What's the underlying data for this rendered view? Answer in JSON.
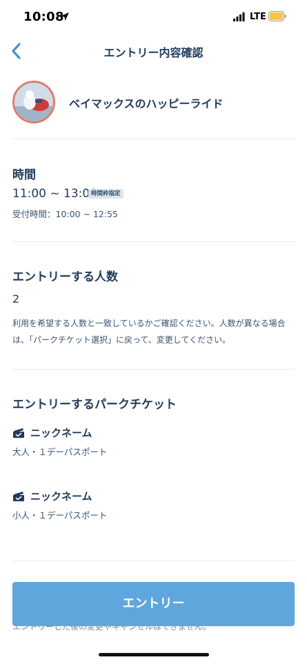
{
  "status_bar": {
    "time": "10:08",
    "network": "LTE"
  },
  "header": {
    "title": "エントリー内容確認",
    "back_icon": "chevron-left-icon"
  },
  "attraction": {
    "name": "ベイマックスのハッピーライド"
  },
  "time_section": {
    "title": "時間",
    "value": "11:00 ~ 13:00",
    "badge": "時間枠指定",
    "reception": "受付時間：10:00 ~ 12:55"
  },
  "people_section": {
    "title": "エントリーする人数",
    "count": "2",
    "note": "利用を希望する人数と一致しているかご確認ください。人数が異なる場合は、「パークチケット選択」に戻って、変更してください。"
  },
  "tickets_section": {
    "title": "エントリーするパークチケット",
    "tickets": [
      {
        "name": "ニックネーム",
        "type": "大人・１デーパスポート"
      },
      {
        "name": "ニックネーム",
        "type": "小人・１デーパスポート"
      }
    ]
  },
  "footer": {
    "button_label": "エントリー",
    "note": "エントリーした後の変更やキャンセルはできません。"
  },
  "colors": {
    "primary_text": "#1f3a5a",
    "button": "#5fa6dd",
    "back_chevron": "#4a90c8",
    "thumbnail_border": "#e07b6a"
  }
}
